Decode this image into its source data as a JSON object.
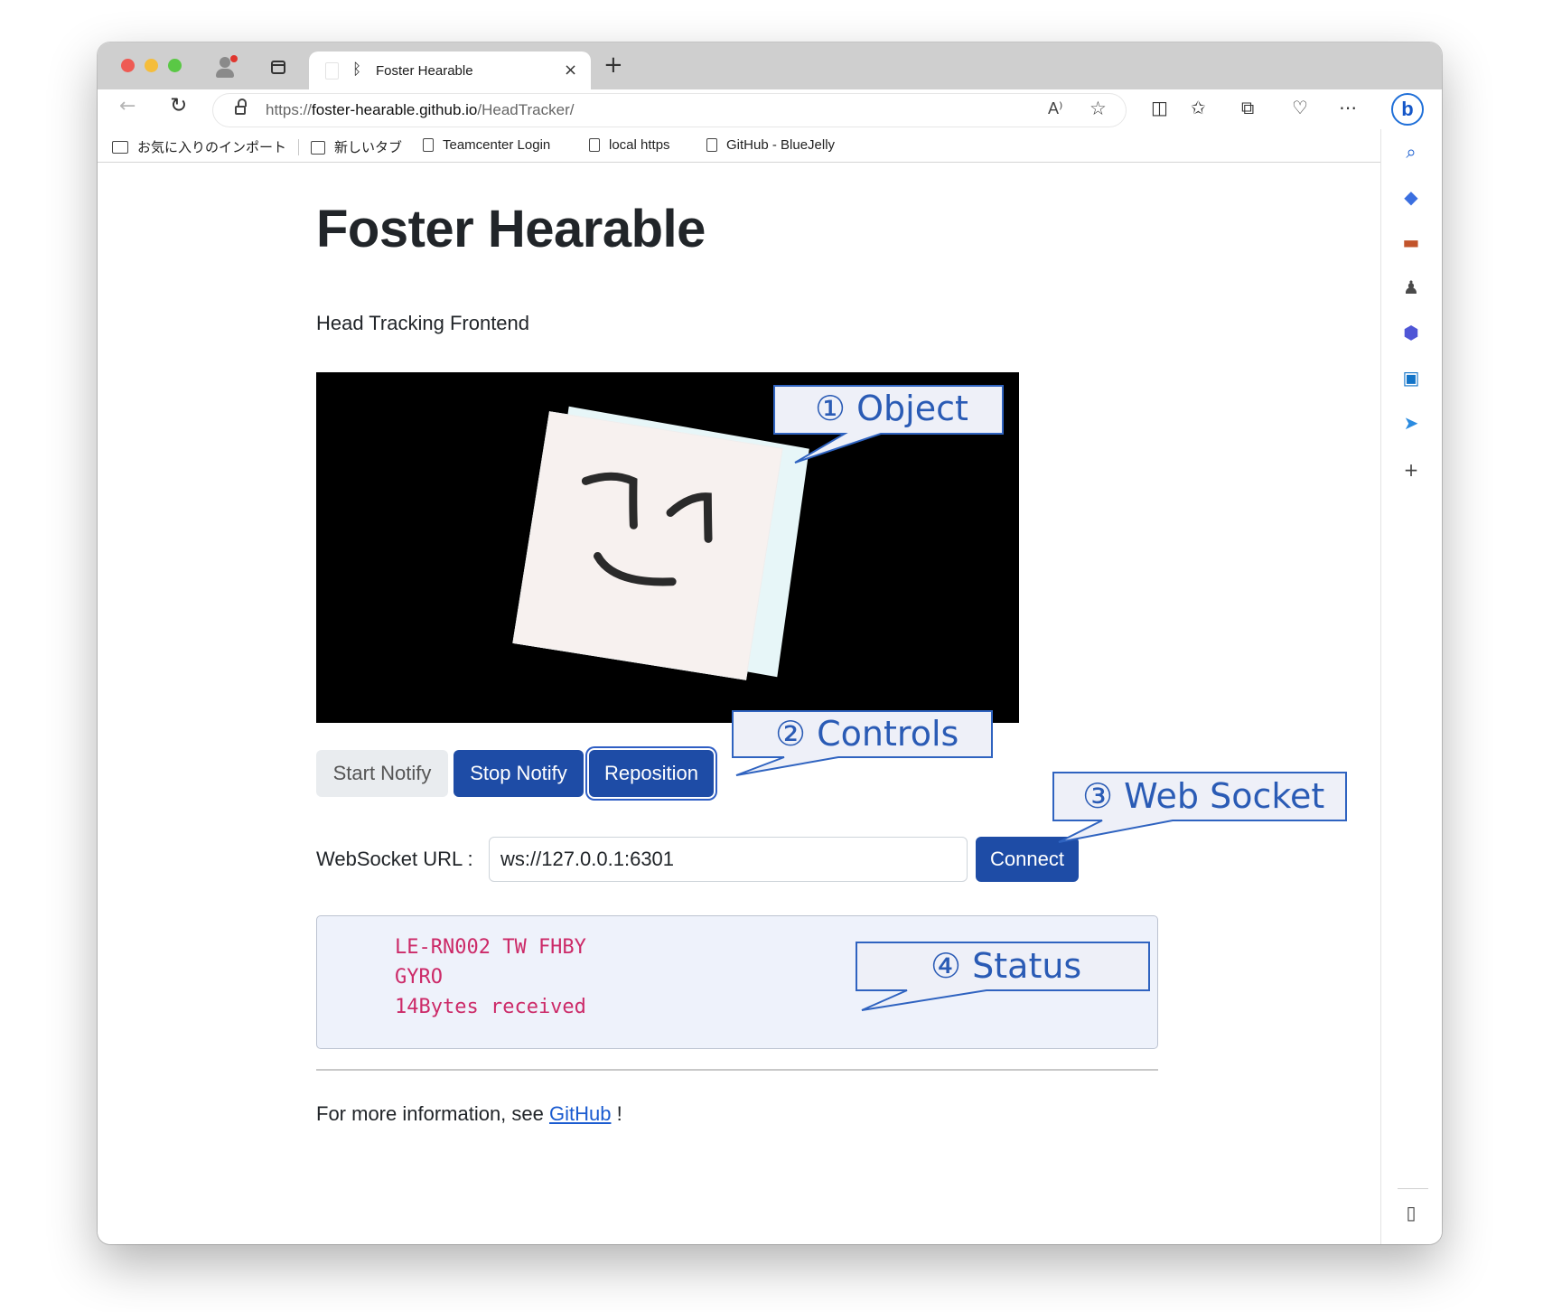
{
  "browser": {
    "tab_title": "Foster Hearable",
    "tab_icon": "bluetooth-icon",
    "close_glyph": "×",
    "newtab_glyph": "+",
    "url_scheme": "https://",
    "url_host": "foster-hearable.github.io",
    "url_path": "/HeadTracker/",
    "read_aloud_glyph": "A⁾",
    "bing_glyph": "b"
  },
  "bookmarks": [
    {
      "label": "お気に入りのインポート",
      "icon": "folder-import-icon"
    },
    {
      "label": "新しいタブ",
      "icon": "new-tab-icon"
    },
    {
      "label": "Teamcenter Login",
      "icon": "page-icon"
    },
    {
      "label": "local https",
      "icon": "page-icon"
    },
    {
      "label": "GitHub - BlueJelly",
      "icon": "page-icon"
    }
  ],
  "page": {
    "title": "Foster Hearable",
    "subtitle": "Head Tracking Frontend",
    "buttons": {
      "start": "Start Notify",
      "stop": "Stop Notify",
      "reposition": "Reposition"
    },
    "ws_label": "WebSocket URL :",
    "ws_value": "ws://127.0.0.1:6301",
    "connect": "Connect",
    "status_lines": [
      "LE-RN002 TW FHBY",
      "GYRO",
      "14Bytes received"
    ],
    "footer_prefix": "For more information, see ",
    "footer_link": "GitHub",
    "footer_suffix": " !"
  },
  "callouts": {
    "object": "① Object",
    "controls": "② Controls",
    "websocket": "③ Web Socket",
    "status": "④ Status"
  },
  "colors": {
    "primary_button": "#1e4ca6",
    "status_text": "#cc2a68",
    "callout_text": "#2a5bb5",
    "link": "#1a5bd0"
  }
}
